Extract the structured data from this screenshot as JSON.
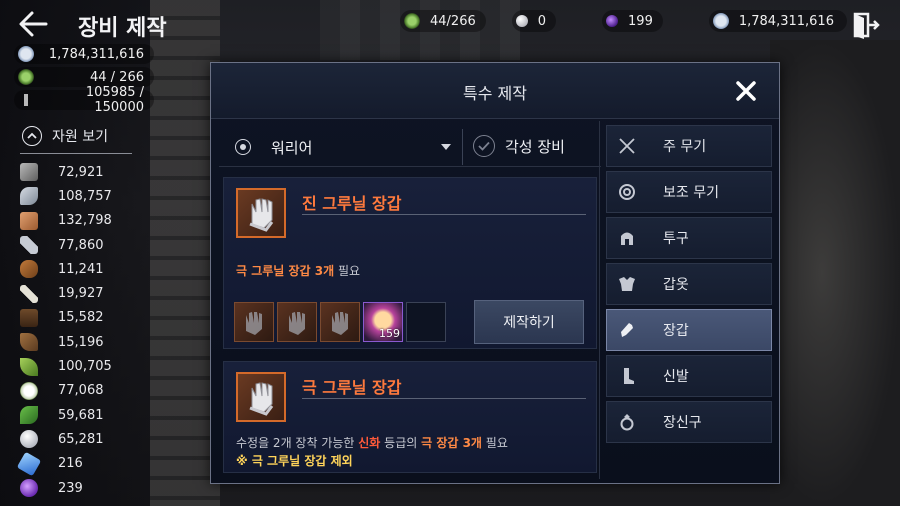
{
  "header": {
    "title": "장비 제작"
  },
  "topbar": {
    "items": [
      {
        "icon": "gem-green-icon",
        "value": "44/266"
      },
      {
        "icon": "pearl-icon",
        "value": "0"
      },
      {
        "icon": "purple-orb-icon",
        "value": "199"
      },
      {
        "icon": "silver-coin-icon",
        "value": "1,784,311,616"
      }
    ]
  },
  "left_currencies": [
    {
      "icon": "silver-coin-icon",
      "value": "1,784,311,616"
    },
    {
      "icon": "gem-green-icon",
      "value": "44 / 266"
    },
    {
      "icon": "wheat-icon",
      "value": "105985 / 150000"
    }
  ],
  "resources": {
    "toggle_label": "자원 보기",
    "items": [
      {
        "icon": "ore-icon",
        "value": "72,921"
      },
      {
        "icon": "stone-icon",
        "value": "108,757"
      },
      {
        "icon": "leather-icon",
        "value": "132,798"
      },
      {
        "icon": "feather-icon",
        "value": "77,860"
      },
      {
        "icon": "log-icon",
        "value": "11,241"
      },
      {
        "icon": "bone-icon",
        "value": "19,927"
      },
      {
        "icon": "bark-icon",
        "value": "15,582"
      },
      {
        "icon": "root-icon",
        "value": "15,196"
      },
      {
        "icon": "leaf-icon",
        "value": "100,705"
      },
      {
        "icon": "cotton-icon",
        "value": "77,068"
      },
      {
        "icon": "herb-icon",
        "value": "59,681"
      },
      {
        "icon": "egg-icon",
        "value": "65,281"
      },
      {
        "icon": "crystal-icon",
        "value": "216"
      },
      {
        "icon": "purple-gem-icon",
        "value": "239"
      }
    ]
  },
  "dialog": {
    "title": "특수 제작",
    "class_select": "워리어",
    "awaken_label": "각성 장비",
    "recipes": [
      {
        "name": "진 그루닐 장갑",
        "req_item": "극 그루닐 장갑 3개",
        "req_suffix": " 필요",
        "slots": [
          {
            "type": "glove",
            "count": ""
          },
          {
            "type": "glove",
            "count": ""
          },
          {
            "type": "glove",
            "count": ""
          },
          {
            "type": "orb",
            "count": "159"
          },
          {
            "type": "empty",
            "count": ""
          }
        ],
        "craft_label": "제작하기"
      },
      {
        "name": "극 그루닐 장갑",
        "req_prefix": "수정을 2개 장착 가능한 ",
        "req_grade": "신화",
        "req_mid": " 등급의 ",
        "req_item": "극 장갑 3개",
        "req_suffix": " 필요",
        "note": "※ 극 그루닐 장갑 제외"
      }
    ],
    "categories": [
      {
        "icon": "crossed-swords-icon",
        "label": "주 무기",
        "active": false
      },
      {
        "icon": "shield-ring-icon",
        "label": "보조 무기",
        "active": false
      },
      {
        "icon": "helmet-icon",
        "label": "투구",
        "active": false
      },
      {
        "icon": "armor-icon",
        "label": "갑옷",
        "active": false
      },
      {
        "icon": "glove-icon",
        "label": "장갑",
        "active": true
      },
      {
        "icon": "boot-icon",
        "label": "신발",
        "active": false
      },
      {
        "icon": "ring-icon",
        "label": "장신구",
        "active": false
      }
    ]
  },
  "colors": {
    "accent_orange": "#ff7a3d",
    "grade_red": "#ff5a3a",
    "highlight_yellow": "#ffd45a",
    "active_tab": "#4a5878"
  }
}
